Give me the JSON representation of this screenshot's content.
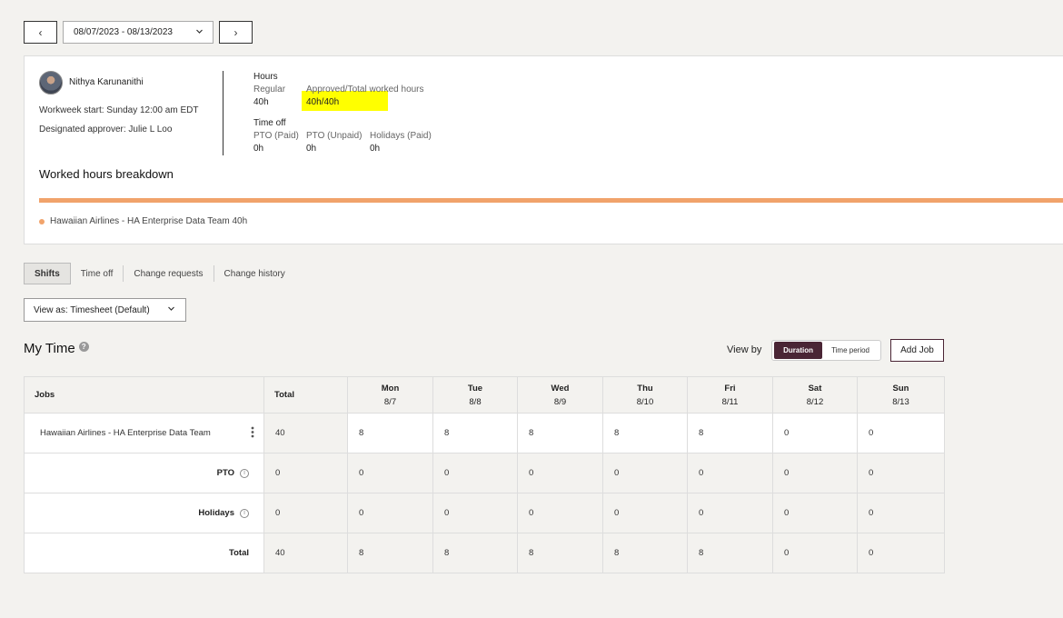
{
  "date_nav": {
    "range": "08/07/2023 - 08/13/2023",
    "prev_icon": "‹",
    "next_icon": "›"
  },
  "employee": {
    "name": "Nithya Karunanithi",
    "workweek_start": "Workweek start: Sunday 12:00 am EDT",
    "designated_approver": "Designated approver: Julie L Loo"
  },
  "hours": {
    "title": "Hours",
    "regular_label": "Regular",
    "regular_value": "40h",
    "approved_label": "Approved/Total worked hours",
    "approved_value": "40h/40h"
  },
  "time_off": {
    "title": "Time off",
    "items": [
      {
        "label": "PTO (Paid)",
        "value": "0h"
      },
      {
        "label": "PTO (Unpaid)",
        "value": "0h"
      },
      {
        "label": "Holidays (Paid)",
        "value": "0h"
      }
    ]
  },
  "breakdown": {
    "title": "Worked hours breakdown",
    "legend": "Hawaiian Airlines - HA Enterprise Data Team 40h",
    "color": "#f1a36b"
  },
  "tabs": [
    "Shifts",
    "Time off",
    "Change requests",
    "Change history"
  ],
  "view_as": "View as: Timesheet (Default)",
  "my_time": {
    "title": "My Time",
    "help_icon": "?"
  },
  "view_by": {
    "label": "View by",
    "options": [
      "Duration",
      "Time period"
    ],
    "selected": "Duration"
  },
  "add_job": "Add Job",
  "table": {
    "headers": {
      "jobs": "Jobs",
      "total": "Total",
      "days": [
        {
          "day": "Mon",
          "date": "8/7"
        },
        {
          "day": "Tue",
          "date": "8/8"
        },
        {
          "day": "Wed",
          "date": "8/9"
        },
        {
          "day": "Thu",
          "date": "8/10"
        },
        {
          "day": "Fri",
          "date": "8/11"
        },
        {
          "day": "Sat",
          "date": "8/12"
        },
        {
          "day": "Sun",
          "date": "8/13"
        }
      ]
    },
    "job_row": {
      "name": "Hawaiian Airlines - HA Enterprise Data Team",
      "total": "40",
      "values": [
        "8",
        "8",
        "8",
        "8",
        "8",
        "0",
        "0"
      ]
    },
    "pto_row": {
      "label": "PTO",
      "total": "0",
      "values": [
        "0",
        "0",
        "0",
        "0",
        "0",
        "0",
        "0"
      ]
    },
    "holidays_row": {
      "label": "Holidays",
      "total": "0",
      "values": [
        "0",
        "0",
        "0",
        "0",
        "0",
        "0",
        "0"
      ]
    },
    "total_row": {
      "label": "Total",
      "total": "40",
      "values": [
        "8",
        "8",
        "8",
        "8",
        "8",
        "0",
        "0"
      ]
    }
  },
  "accent_color": "#4a2535",
  "highlight_color": "#ffff00"
}
